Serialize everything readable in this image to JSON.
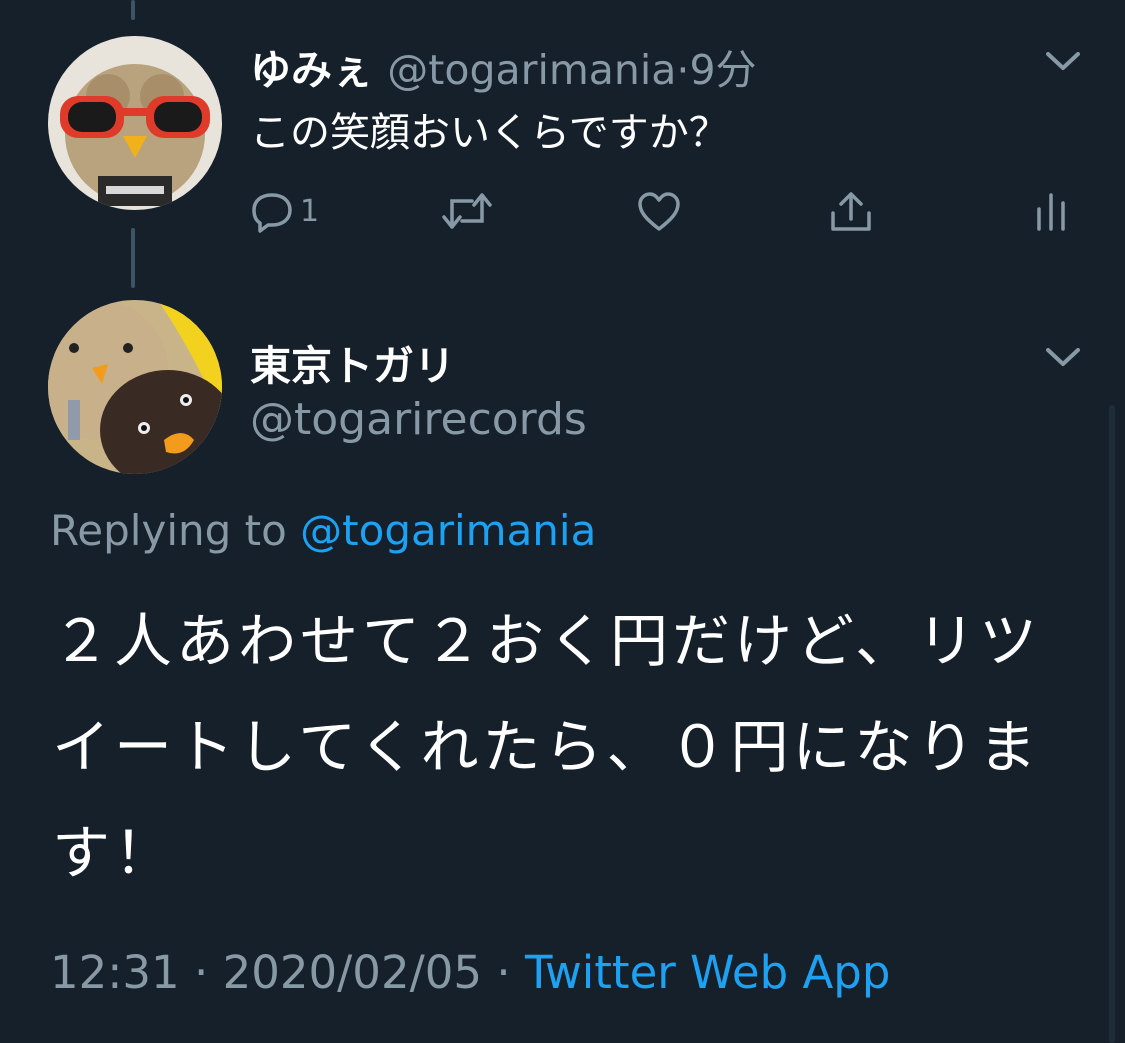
{
  "tweet1": {
    "display_name": "ゆみぇ",
    "handle": "@togarimania",
    "separator": "·",
    "time": "9分",
    "text": "この笑顔おいくらですか？",
    "reply_count": "1"
  },
  "tweet2": {
    "display_name": "東京トガリ",
    "handle": "@togarirecords",
    "replying_prefix": "Replying to",
    "replying_handle": "@togarimania",
    "body": "２人あわせて２おく円だけど、リツイートしてくれたら、０円になります！",
    "time": "12:31",
    "date": "2020/02/05",
    "separator": "·",
    "source": "Twitter Web App"
  },
  "colors": {
    "background": "#15202b",
    "muted": "#8899a6",
    "link": "#1da1f2",
    "thread_line": "#3d5466"
  },
  "icons": [
    "chevron-down-icon",
    "reply-icon",
    "retweet-icon",
    "like-icon",
    "share-icon",
    "analytics-icon"
  ]
}
